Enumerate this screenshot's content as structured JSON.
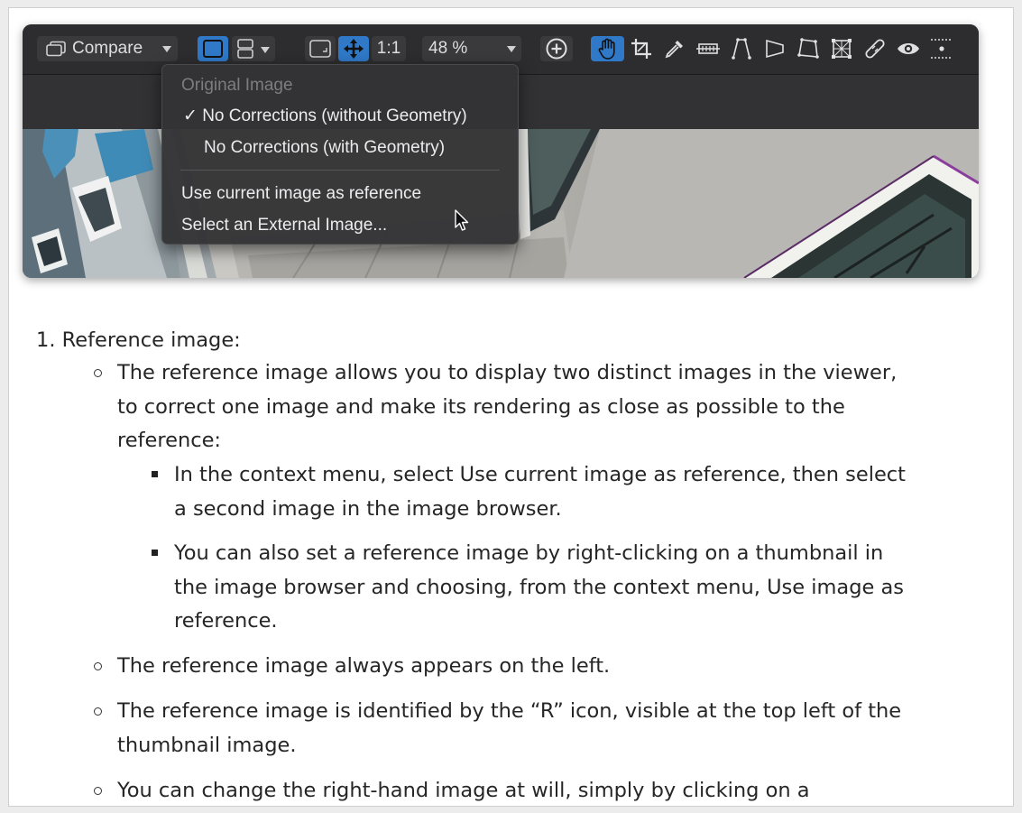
{
  "toolbar": {
    "compare_label": "Compare",
    "one_to_one_label": "1:1",
    "zoom_value": "48 %",
    "icons": {
      "compare": "compare-window-icon",
      "single_view": "single-view-icon",
      "split_view": "split-view-icon",
      "fit": "fit-window-icon",
      "move": "move-arrows-icon",
      "zoom_in": "zoom-in-icon",
      "tools": [
        "hand-icon",
        "crop-icon",
        "eyedropper-icon",
        "horizon-icon",
        "vertical-perspective-icon",
        "horizontal-perspective-icon",
        "rectangle-perspective-icon",
        "eight-point-icon",
        "repair-icon",
        "eye-icon",
        "white-balance-icon"
      ]
    },
    "accent": "#2f79c8"
  },
  "menu": {
    "header": "Original Image",
    "items": [
      {
        "label": "No Corrections (without Geometry)",
        "checked": true
      },
      {
        "label": "No Corrections (with Geometry)",
        "checked": false
      },
      {
        "label": "Use current image as reference",
        "checked": false
      },
      {
        "label": "Select an External Image...",
        "checked": false
      }
    ],
    "check_mark": "✓"
  },
  "doc": {
    "item1_number": "1.",
    "item1_title": "Reference image:",
    "b1_lines": [
      "The reference image allows you to display two distinct images in the viewer,",
      "to correct one image and make its rendering as close as possible to the",
      "reference:"
    ],
    "sub1_lines": [
      "In the context menu, select Use current image as reference, then select",
      "a second image in the image browser."
    ],
    "sub2_lines": [
      "You can also set a reference image by right-clicking on a thumbnail in",
      "the image browser and choosing, from the context menu, Use image as",
      "reference."
    ],
    "b2_lines": [
      "The reference image always appears on the left."
    ],
    "b3_lines": [
      "The reference image is identified by the “R” icon, visible at the top left of the",
      "thumbnail image."
    ],
    "b4_lines": [
      "You can change the right-hand image at will, simply by clicking on a"
    ]
  }
}
